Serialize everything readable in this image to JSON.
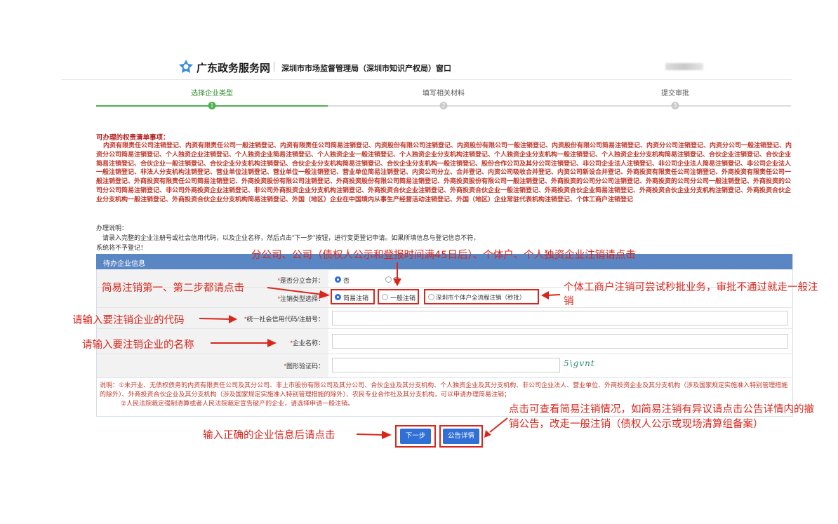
{
  "header": {
    "site_title": "广东政务服务网",
    "window_title": "深圳市市场监督管理局（深圳市知识产权局）窗口"
  },
  "steps": [
    {
      "label": "选择企业类型",
      "number": "1",
      "active": true
    },
    {
      "label": "填写相关材料",
      "number": "2",
      "active": false
    },
    {
      "label": "提交审批",
      "number": "3",
      "active": false
    }
  ],
  "rights": {
    "title": "可办理的权责清单事项：",
    "body": "内资有限责任公司注销登记、内资有限责任公司一般注销登记、内资有限责任公司简易注销登记、内资股份有限公司注销登记、内资股份有限公司一般注销登记、内资股份有限公司简易注销登记、内资分公司注销登记、内资分公司一般注销登记、内资分公司简易注销登记、个人独资企业注销登记、个人独资企业简易注销登记、个人独资企业一般注销登记、个人独资企业分支机构注销登记、个人独资企业分支机构一般注销登记、个人独资企业分支机构简易注销登记、合伙企业注销登记、合伙企业简易注销登记、合伙企业一般注销登记、合伙企业分支机构注销登记、合伙企业分支机构简易注销登记、合伙企业分支机构一般注销登记、股份合作公司及其分公司注销登记、非公司企业法人注销登记、非公司企业法人简易注销登记、非公司企业法人一般注销登记、非法人分支机构注销登记、营业单位注销登记、营业单位一般注销登记、营业单位简易注销登记、内资公司分立、合并登记、内资公司吸收合并登记、内资公司新设合并登记、外商投资有限责任公司注销登记、外商投资有限责任公司一般注销登记、外商投资有限责任公司简易注销登记、外商投资股份有限公司注销登记、外商投资股份有限公司简易注销登记、外商投资股份有限公司一般注销登记、外商投资的公司分公司注销登记、外商投资的公司分公司一般注销登记、外商投资的公司分公司简易注销登记、非公司外商投资企业注销登记、非公司外商投资企业分支机构注销登记、外商投资合伙企业注销登记、外商投资合伙企业一般注销登记、外商投资合伙企业简易注销登记、外商投资合伙企业分支机构注销登记、外商投资合伙企业分支机构一般注销登记、外商投资合伙企业分支机构简易注销登记、外国（地区）企业在中国境内从事生产经营活动注销登记、外国（地区）企业常驻代表机构注销登记、个体工商户注销登记"
  },
  "instructions": {
    "title": "办理说明：",
    "line1": "请录入完整的企业注册号或社会信用代码，以及企业名称，然后点击\"下一步\"按钮，进行变更登记申请。如果所填信息与登记信息不符，",
    "line2": "系统将不予登记！"
  },
  "panel": {
    "title": "待办企业信息",
    "branch_merge": {
      "label": "是否分立合并：",
      "options": [
        "否",
        "是"
      ]
    },
    "cancel_type": {
      "label": "注销类型选择：",
      "options": [
        "简易注销",
        "一般注销",
        "深圳市个体户全流程注销（秒批）"
      ]
    },
    "credit_code": {
      "label": "统一社会信用代码/注册号：",
      "value": ""
    },
    "company_name": {
      "label": "企业名称：",
      "value": ""
    },
    "captcha": {
      "label": "图形验证码：",
      "value": "",
      "image_text": "5\\gvnt"
    },
    "note1": "说明：①未开业、无债权债务的内资有限责任公司及其分公司、非上市股份有限公司及其分公司、合伙企业及其分支机构、个人独资企业及其分支机构、非公司企业法人、营业单位、外商投资企业及其分支机构（涉及国家规定实施准入特别管理措施的除外）、外商投资合伙企业及其分支机构（涉及国家规定实施准入特别管理措施的除外）、农民专业合作社及其分支机构，可以申请办理简易注销；",
    "note2": "②人民法院裁定强制清算或者人民法院裁定宣告破产的企业，请选择申请一般注销。"
  },
  "buttons": {
    "next": "下一步",
    "notice": "公告详情"
  },
  "annotations": {
    "top": "分公司、公司（债权人公示和登报时间满45日后）、个体户、个人独资企业注销请点击",
    "simple": "简易注销第一、第二步都请点击",
    "individual": "个体工商户注销可尝试秒批业务，审批不通过就走一般注销",
    "code": "请输入要注销企业的代码",
    "name": "请输入要注销企业的名称",
    "next": "输入正确的企业信息后请点击",
    "notice": "点击可查看简易注销情况，如简易注销有异议请点击公告详情内的撤销公告，改走一般注销（债权人公示或现场清算组备案）"
  },
  "colors": {
    "accent": "#2f6fd6",
    "annotation": "#d9261c",
    "step_active": "#4caf50",
    "panel_header": "#5b86c4"
  }
}
